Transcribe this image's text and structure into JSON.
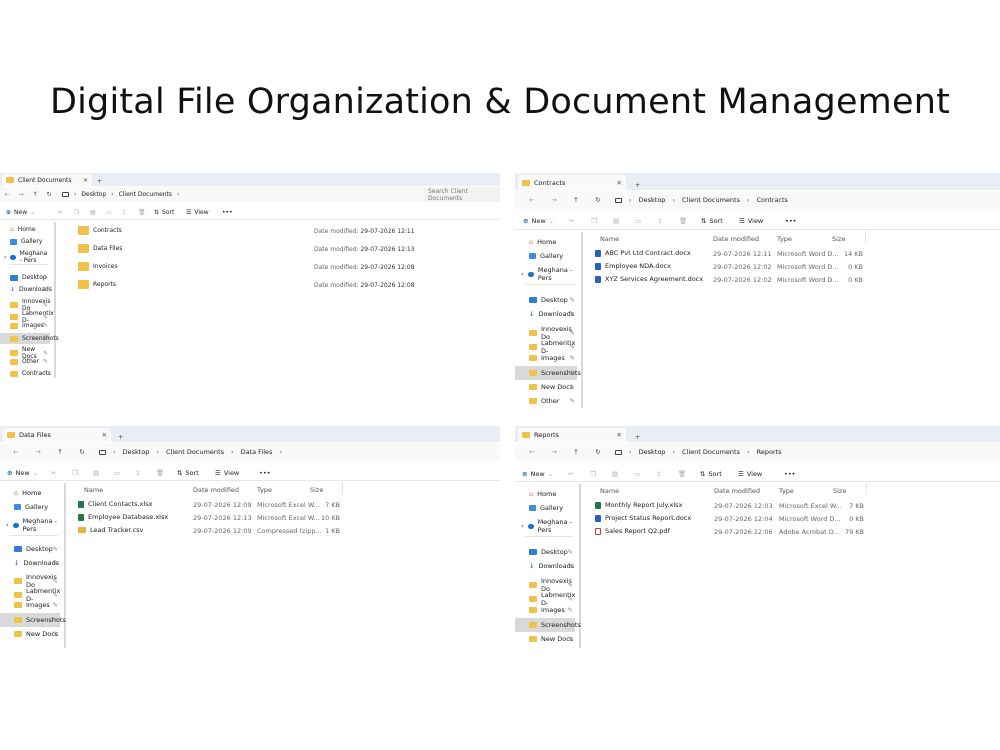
{
  "page_title": "Digital File Organization & Document Management",
  "common": {
    "new_label": "New",
    "sort_label": "Sort",
    "view_label": "View",
    "more_label": "•••",
    "desktop": "Desktop",
    "client_docs": "Client Documents",
    "col_name": "Name",
    "col_date": "Date modified",
    "col_type": "Type",
    "col_size": "Size",
    "date_modified_prefix": "Date modified:"
  },
  "sidebar_labels": {
    "home": "Home",
    "gallery": "Gallery",
    "meghana": "Meghana - Pers",
    "desktop": "Desktop",
    "downloads": "Downloads",
    "innovexis": "Innovexis Do",
    "labmentix": "Labmentix D-",
    "images": "Images",
    "screenshots": "Screenshots",
    "newdocs": "New Docs",
    "other": "Other",
    "contracts": "Contracts"
  },
  "win1": {
    "tab": "Client Documents",
    "search_placeholder": "Search Client Documents",
    "folders": [
      {
        "name": "Contracts",
        "modified": "29-07-2026 12:11"
      },
      {
        "name": "Data Files",
        "modified": "29-07-2026 12:13"
      },
      {
        "name": "Invoices",
        "modified": "29-07-2026 12:08"
      },
      {
        "name": "Reports",
        "modified": "29-07-2026 12:08"
      }
    ]
  },
  "win2": {
    "tab": "Contracts",
    "crumb": "Contracts",
    "files": [
      {
        "name": "ABC Pvt Ltd Contract.docx",
        "date": "29-07-2026 12:11",
        "type": "Microsoft Word D...",
        "size": "14 KB"
      },
      {
        "name": "Employee NDA.docx",
        "date": "29-07-2026 12:02",
        "type": "Microsoft Word D...",
        "size": "0 KB"
      },
      {
        "name": "XYZ Services Agreement.docx",
        "date": "29-07-2026 12:02",
        "type": "Microsoft Word D...",
        "size": "0 KB"
      }
    ]
  },
  "win3": {
    "tab": "Data Files",
    "crumb": "Data Files",
    "files": [
      {
        "name": "Client Contacts.xlsx",
        "date": "29-07-2026 12:09",
        "type": "Microsoft Excel W...",
        "size": "7 KB"
      },
      {
        "name": "Employee Database.xlsx",
        "date": "29-07-2026 12:13",
        "type": "Microsoft Excel W...",
        "size": "10 KB"
      },
      {
        "name": "Lead Tracker.csv",
        "date": "29-07-2026 12:09",
        "type": "Compressed (zipp...",
        "size": "1 KB"
      }
    ]
  },
  "win4": {
    "tab": "Reports",
    "crumb": "Reports",
    "files": [
      {
        "name": "Monthly Report July.xlsx",
        "date": "29-07-2026 12:03",
        "type": "Microsoft Excel W...",
        "size": "7 KB"
      },
      {
        "name": "Project Status Report.docx",
        "date": "29-07-2026 12:04",
        "type": "Microsoft Word D...",
        "size": "0 KB"
      },
      {
        "name": "Sales Report Q2.pdf",
        "date": "29-07-2026 12:06",
        "type": "Adobe Acrobat D...",
        "size": "79 KB"
      }
    ]
  }
}
